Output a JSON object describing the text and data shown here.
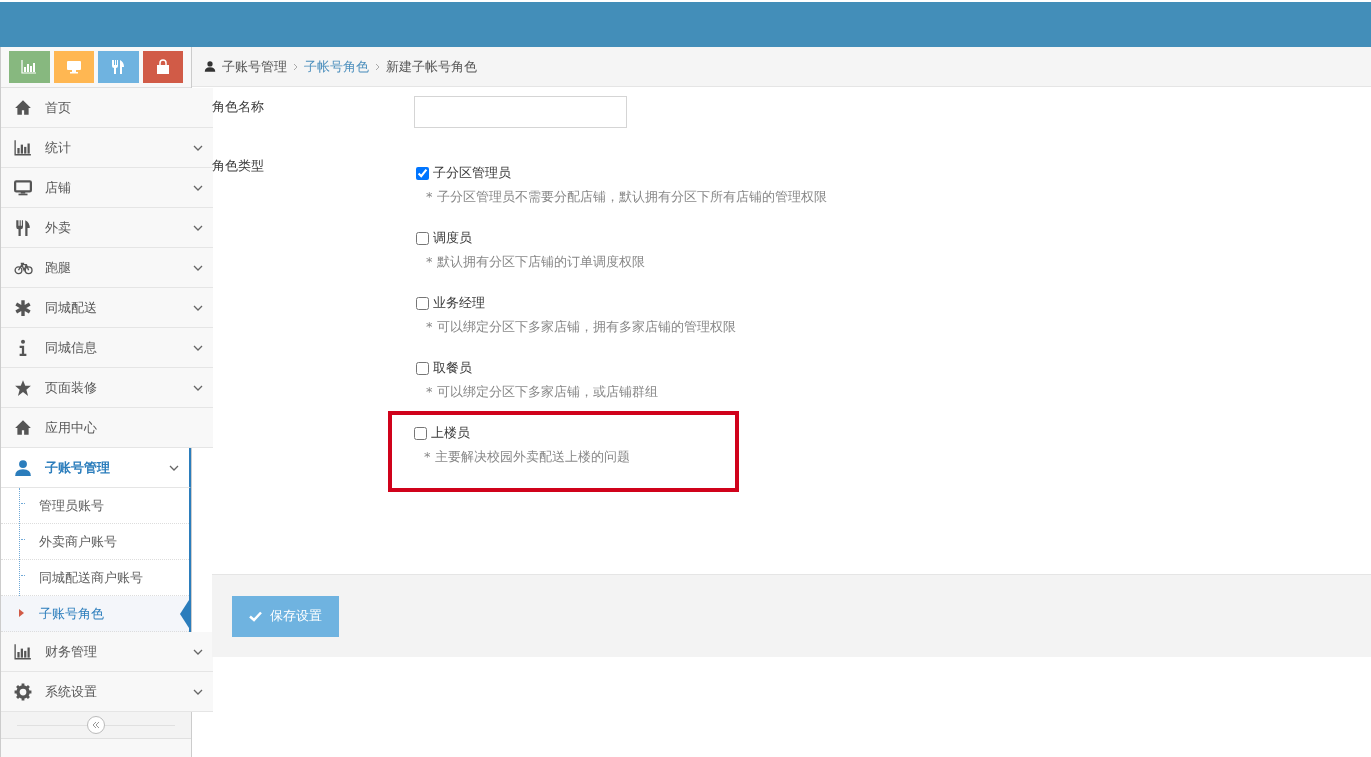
{
  "shortcuts": [
    {
      "color": "#87b87f"
    },
    {
      "color": "#ffb752"
    },
    {
      "color": "#6fb3e0"
    },
    {
      "color": "#d15b47"
    }
  ],
  "sidebar": {
    "items": [
      {
        "label": "首页",
        "selected": false,
        "has_submenu": false
      },
      {
        "label": "统计",
        "selected": false,
        "has_submenu": true
      },
      {
        "label": "店铺",
        "selected": false,
        "has_submenu": true
      },
      {
        "label": "外卖",
        "selected": false,
        "has_submenu": true
      },
      {
        "label": "跑腿",
        "selected": false,
        "has_submenu": true
      },
      {
        "label": "同城配送",
        "selected": false,
        "has_submenu": true
      },
      {
        "label": "同城信息",
        "selected": false,
        "has_submenu": true
      },
      {
        "label": "页面装修",
        "selected": false,
        "has_submenu": true
      },
      {
        "label": "应用中心",
        "selected": false,
        "has_submenu": false
      },
      {
        "label": "子账号管理",
        "selected": true,
        "has_submenu": true,
        "children": [
          {
            "label": "管理员账号",
            "selected": false
          },
          {
            "label": "外卖商户账号",
            "selected": false
          },
          {
            "label": "同城配送商户账号",
            "selected": false
          },
          {
            "label": "子账号角色",
            "selected": true
          }
        ]
      },
      {
        "label": "财务管理",
        "selected": false,
        "has_submenu": true
      },
      {
        "label": "系统设置",
        "selected": false,
        "has_submenu": true
      }
    ]
  },
  "breadcrumb": [
    {
      "label": "子账号管理",
      "kind": "text"
    },
    {
      "label": "子帐号角色",
      "kind": "link"
    },
    {
      "label": "新建子帐号角色",
      "kind": "text"
    }
  ],
  "form": {
    "name_label": "角色名称",
    "type_label": "角色类型",
    "roles": [
      {
        "label": "子分区管理员",
        "checked": true,
        "note": "* 子分区管理员不需要分配店铺，默认拥有分区下所有店铺的管理权限",
        "highlighted": false
      },
      {
        "label": "调度员",
        "checked": false,
        "note": "* 默认拥有分区下店铺的订单调度权限",
        "highlighted": false
      },
      {
        "label": "业务经理",
        "checked": false,
        "note": "* 可以绑定分区下多家店铺，拥有多家店铺的管理权限",
        "highlighted": false
      },
      {
        "label": "取餐员",
        "checked": false,
        "note": "* 可以绑定分区下多家店铺，或店铺群组",
        "highlighted": false
      },
      {
        "label": "上楼员",
        "checked": false,
        "note": "* 主要解决校园外卖配送上楼的问题",
        "highlighted": true
      }
    ]
  },
  "save_button": "保存设置"
}
